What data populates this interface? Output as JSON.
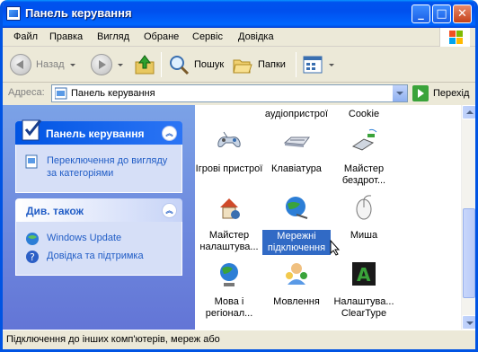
{
  "window": {
    "title": "Панель керування"
  },
  "menu": [
    "Файл",
    "Правка",
    "Вигляд",
    "Обране",
    "Сервіс",
    "Довідка"
  ],
  "toolbar": {
    "back": "Назад",
    "search": "Пошук",
    "folders": "Папки"
  },
  "address": {
    "label": "Адреса:",
    "value": "Панель керування",
    "go": "Перехід"
  },
  "left_pane": {
    "cp_title": "Панель керування",
    "switch_link": "Переключення до вигляду за категоріями",
    "see_also_title": "Див. також",
    "links": [
      "Windows Update",
      "Довідка та підтримка"
    ]
  },
  "items_top_row": [
    "аудіопристрої",
    "Cookie"
  ],
  "items": [
    {
      "label": "Ігрові пристрої",
      "icon": "game-controller-icon"
    },
    {
      "label": "Клавіатура",
      "icon": "keyboard-icon"
    },
    {
      "label": "Майстер бездрот...",
      "icon": "wireless-wizard-icon"
    },
    {
      "label": "Майстер налаштува...",
      "icon": "network-setup-wizard-icon"
    },
    {
      "label": "Мережні підключення",
      "icon": "network-connections-icon"
    },
    {
      "label": "Миша",
      "icon": "mouse-icon"
    },
    {
      "label": "Мова і регіонал...",
      "icon": "regional-options-icon"
    },
    {
      "label": "Мовлення",
      "icon": "speech-icon"
    },
    {
      "label": "Налаштува... ClearType",
      "icon": "cleartype-icon"
    }
  ],
  "status": {
    "text": "Підключення до інших комп'ютерів, мереж або"
  },
  "colors": {
    "titlebar": "#0054e3",
    "left_pane": "#6f8fe0",
    "selection": "#316ac5"
  }
}
